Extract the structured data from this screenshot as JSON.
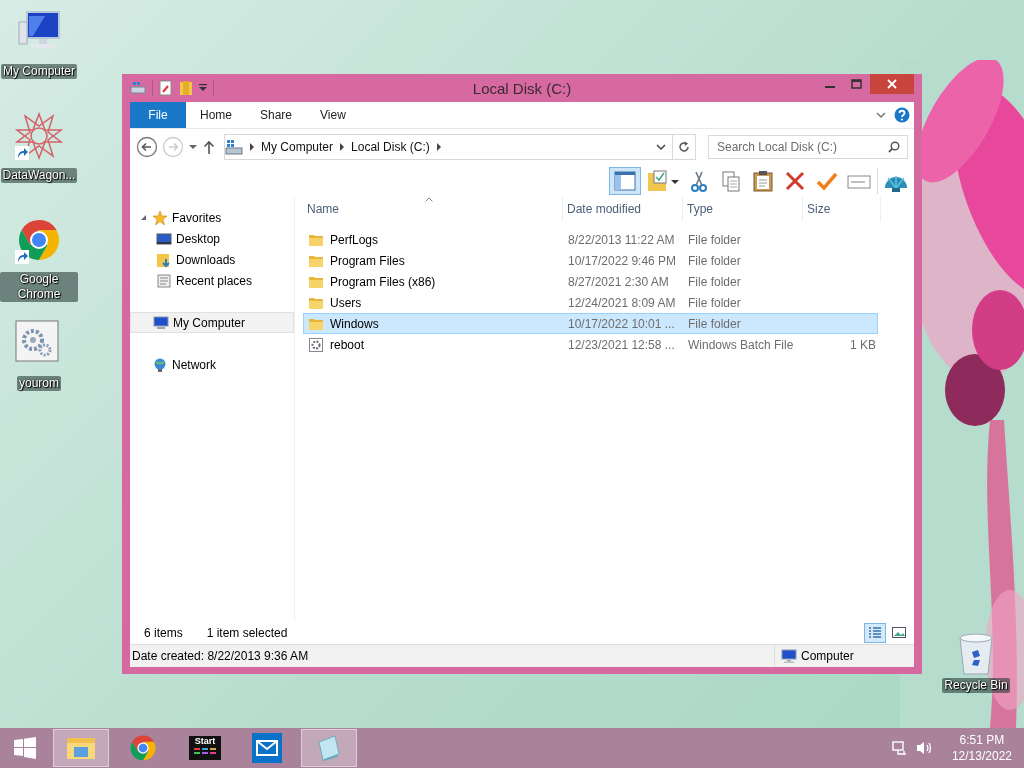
{
  "desktop_icons": [
    {
      "label": "My Computer",
      "kind": "computer",
      "shortcut": false
    },
    {
      "label": "DataWagon...",
      "kind": "emblem",
      "shortcut": true
    },
    {
      "label": "Google Chrome",
      "kind": "chrome",
      "shortcut": true
    },
    {
      "label": "yourom",
      "kind": "settings",
      "shortcut": false
    }
  ],
  "recycle_bin": {
    "label": "Recycle Bin"
  },
  "window": {
    "title": "Local Disk (C:)",
    "ribbon_tabs": [
      {
        "label": "File",
        "kind": "file"
      },
      {
        "label": "Home",
        "kind": "tab"
      },
      {
        "label": "Share",
        "kind": "tab"
      },
      {
        "label": "View",
        "kind": "tab"
      }
    ],
    "address": {
      "crumbs": [
        "My Computer",
        "Local Disk (C:)"
      ]
    },
    "search": {
      "placeholder": "Search Local Disk (C:)"
    },
    "toolbar": [
      {
        "kind": "preview-pane",
        "on": true
      },
      {
        "kind": "properties",
        "on": false
      },
      {
        "kind": "cut",
        "on": false
      },
      {
        "kind": "copy",
        "on": false
      },
      {
        "kind": "paste",
        "on": false
      },
      {
        "kind": "delete",
        "on": false
      },
      {
        "kind": "apply",
        "on": false
      },
      {
        "kind": "rename",
        "on": false
      },
      {
        "kind": "shell",
        "on": false
      }
    ],
    "nav": [
      {
        "label": "Favorites",
        "kind": "favorites",
        "expanded": true,
        "selected": false,
        "children": [
          {
            "label": "Desktop",
            "kind": "desktop",
            "selected": false
          },
          {
            "label": "Downloads",
            "kind": "downloads",
            "selected": false
          },
          {
            "label": "Recent places",
            "kind": "recent",
            "selected": false
          }
        ]
      },
      {
        "label": "My Computer",
        "kind": "computer",
        "selected": true
      },
      {
        "label": "Network",
        "kind": "network",
        "selected": false
      }
    ],
    "columns": [
      {
        "label": "Name",
        "sorted": true
      },
      {
        "label": "Date modified",
        "sorted": false
      },
      {
        "label": "Type",
        "sorted": false
      },
      {
        "label": "Size",
        "sorted": false
      }
    ],
    "rows": [
      {
        "name": "PerfLogs",
        "date": "8/22/2013 11:22 AM",
        "type": "File folder",
        "kind": "folder",
        "selected": false
      },
      {
        "name": "Program Files",
        "date": "10/17/2022 9:46 PM",
        "type": "File folder",
        "kind": "folder",
        "selected": false
      },
      {
        "name": "Program Files (x86)",
        "date": "8/27/2021 2:30 AM",
        "type": "File folder",
        "kind": "folder",
        "selected": false
      },
      {
        "name": "Users",
        "date": "12/24/2021 8:09 AM",
        "type": "File folder",
        "kind": "folder",
        "selected": false
      },
      {
        "name": "Windows",
        "date": "10/17/2022 10:01 ...",
        "type": "File folder",
        "kind": "folder",
        "selected": true
      },
      {
        "name": "reboot",
        "date": "12/23/2021 12:58 ...",
        "type": "Windows Batch File",
        "size": "1 KB",
        "kind": "batch",
        "selected": false
      }
    ],
    "item_count": "6 items",
    "selection_count": "1 item selected",
    "view_buttons": [
      {
        "kind": "details",
        "selected": true
      },
      {
        "kind": "large-icons",
        "selected": false
      }
    ],
    "status_bar": {
      "info": "Date created: 8/22/2013 9:36 AM",
      "location": "Computer"
    }
  },
  "taskbar": {
    "items": [
      {
        "kind": "explorer",
        "active": true
      },
      {
        "kind": "chrome",
        "active": false
      },
      {
        "kind": "start-app",
        "label": "Start",
        "active": false
      },
      {
        "kind": "mail",
        "active": false
      },
      {
        "kind": "notes",
        "active": true
      }
    ],
    "time": "6:51 PM",
    "date": "12/13/2022"
  }
}
